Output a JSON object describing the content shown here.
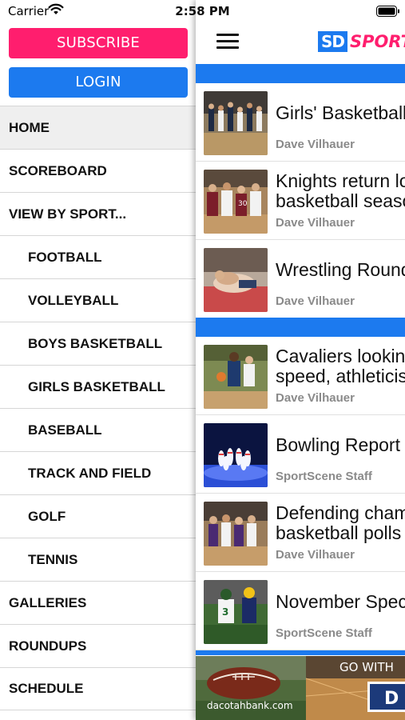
{
  "status_bar": {
    "carrier": "Carrier",
    "time": "2:58 PM"
  },
  "side_menu": {
    "subscribe_label": "SUBSCRIBE",
    "login_label": "LOGIN",
    "items": [
      {
        "label": "HOME",
        "level": "top",
        "active": true
      },
      {
        "label": "SCOREBOARD",
        "level": "top"
      },
      {
        "label": "VIEW BY SPORT...",
        "level": "top"
      },
      {
        "label": "FOOTBALL",
        "level": "sub"
      },
      {
        "label": "VOLLEYBALL",
        "level": "sub"
      },
      {
        "label": "BOYS BASKETBALL",
        "level": "sub"
      },
      {
        "label": "GIRLS BASKETBALL",
        "level": "sub"
      },
      {
        "label": "BASEBALL",
        "level": "sub"
      },
      {
        "label": "TRACK AND FIELD",
        "level": "sub"
      },
      {
        "label": "GOLF",
        "level": "sub"
      },
      {
        "label": "TENNIS",
        "level": "sub"
      },
      {
        "label": "GALLERIES",
        "level": "top"
      },
      {
        "label": "ROUNDUPS",
        "level": "top"
      },
      {
        "label": "SCHEDULE",
        "level": "top"
      }
    ]
  },
  "header": {
    "logo_sd": "SD",
    "logo_sport": "SPORT"
  },
  "articles": [
    {
      "title": "Girls' Basketball I",
      "author": "Dave Vilhauer"
    },
    {
      "title": "Knights return loa\nbasketball seaso",
      "author": "Dave Vilhauer"
    },
    {
      "title": "Wrestling Roundu",
      "author": "Dave Vilhauer"
    },
    {
      "title": "Cavaliers looking\nspeed, athleticisr",
      "author": "Dave Vilhauer"
    },
    {
      "title": "Bowling Report",
      "author": "SportScene Staff"
    },
    {
      "title": "Defending champ\nbasketball polls",
      "author": "Dave Vilhauer"
    },
    {
      "title": "November Specia",
      "author": "SportScene Staff"
    }
  ],
  "ad": {
    "url_text": "dacotahbank.com",
    "tagline": "GO WITH",
    "logo_text": "D"
  },
  "colors": {
    "brand_pink": "#ff1e6e",
    "brand_blue": "#1c7aef"
  }
}
